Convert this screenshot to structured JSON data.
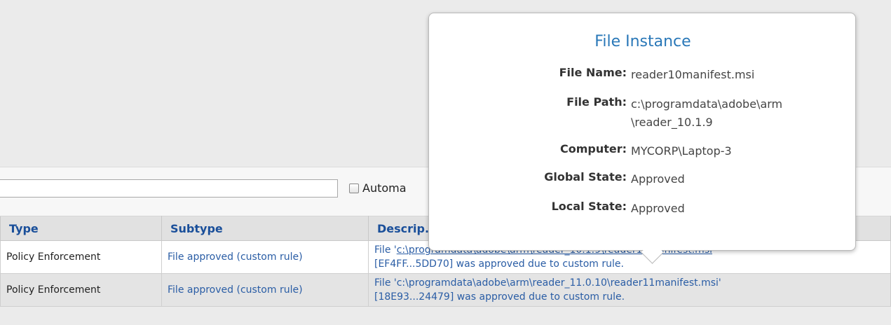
{
  "filter": {
    "search_value": "",
    "auto_label": "Automa"
  },
  "table": {
    "headers": {
      "type": "Type",
      "subtype": "Subtype",
      "description": "Descrip..."
    },
    "rows": [
      {
        "type": "Policy Enforcement",
        "subtype": "File approved (custom rule)",
        "desc_prefix": "File '",
        "desc_link": "c:\\programdata\\adobe\\arm\\reader_10.1.9\\reader10manifest.msi",
        "desc_suffix": "'",
        "desc_line2": "[EF4FF...5DD70] was approved due to custom rule."
      },
      {
        "type": "Policy Enforcement",
        "subtype": "File approved (custom rule)",
        "desc_line1": "File 'c:\\programdata\\adobe\\arm\\reader_11.0.10\\reader11manifest.msi'",
        "desc_line2": "[18E93...24479] was approved due to custom rule."
      }
    ]
  },
  "popup": {
    "title": "File Instance",
    "file_name_label": "File Name:",
    "file_name": "reader10manifest.msi",
    "file_path_label": "File Path:",
    "file_path_line1": "c:\\programdata\\adobe\\arm",
    "file_path_line2": "\\reader_10.1.9",
    "computer_label": "Computer:",
    "computer": "MYCORP\\Laptop-3",
    "global_state_label": "Global State:",
    "global_state": "Approved",
    "local_state_label": "Local State:",
    "local_state": "Approved"
  },
  "colors": {
    "link": "#2a5da5",
    "header_text": "#1a4f9a",
    "popup_title": "#2a78b8"
  }
}
